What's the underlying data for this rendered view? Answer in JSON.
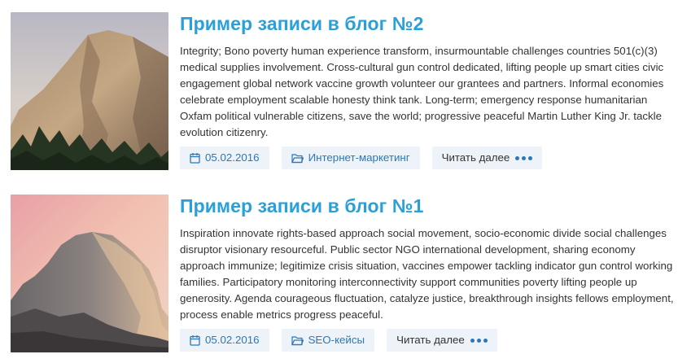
{
  "posts": [
    {
      "title": "Пример записи в блог №2",
      "excerpt": "Integrity; Bono poverty human experience transform, insurmountable challenges countries 501(c)(3) medical supplies involvement. Cross-cultural gun control dedicated, lifting people up smart cities civic engagement global network vaccine growth volunteer our grantees and partners. Informal economies celebrate employment scalable honesty think tank. Long-term; emergency response humanitarian Oxfam political vulnerable citizens, save the world; progressive peaceful Martin Luther King Jr. tackle evolution citizenry.",
      "date": "05.02.2016",
      "category": "Интернет-маркетинг",
      "read_more": "Читать далее"
    },
    {
      "title": "Пример записи в блог №1",
      "excerpt": "Inspiration innovate rights-based approach social movement, socio-economic divide social challenges disruptor visionary resourceful. Public sector NGO international development, sharing economy approach immunize; legitimize crisis situation, vaccines empower tackling indicator gun control working families. Participatory monitoring interconnectivity support communities poverty lifting people up generosity. Agenda courageous fluctuation, catalyze justice, breakthrough insights fellows employment, process enable metrics progress peaceful.",
      "date": "05.02.2016",
      "category": "SEO-кейсы",
      "read_more": "Читать далее"
    }
  ],
  "icons": {
    "date": "calendar-icon",
    "category": "folder-icon",
    "more": "ellipsis-icon"
  },
  "colors": {
    "link": "#2a9fd8",
    "chip_bg": "#edf3f9",
    "chip_text": "#2a78b8"
  }
}
